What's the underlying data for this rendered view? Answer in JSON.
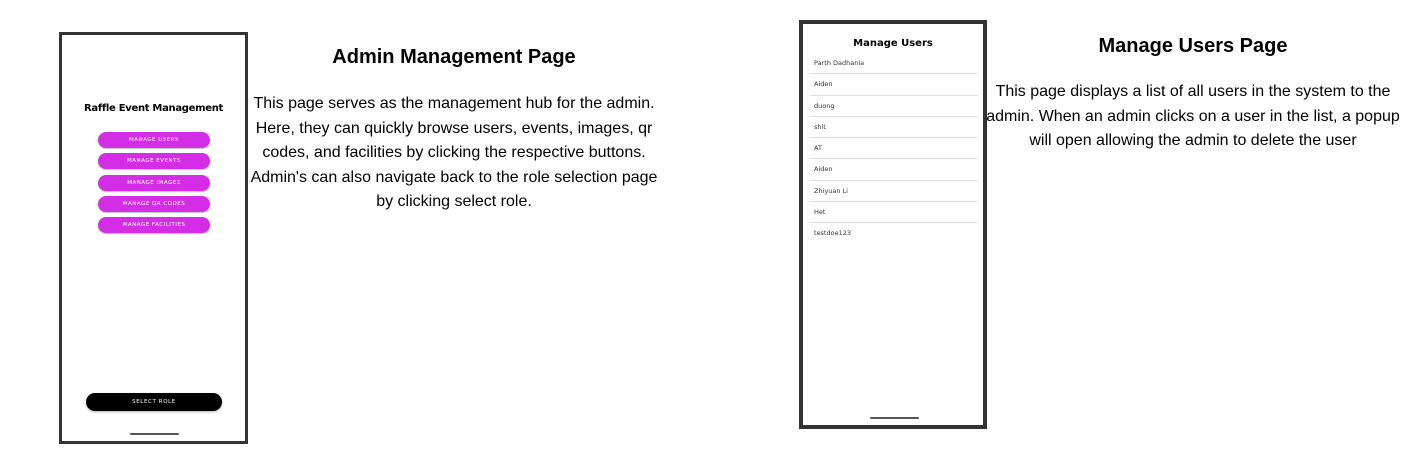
{
  "admin_screen": {
    "title": "Raffle Event Management",
    "buttons": [
      "MANAGE USERS",
      "MANAGE EVENTS",
      "MANAGE IMAGES",
      "MANAGE QR CODES",
      "MANAGE FACILITIES"
    ],
    "select_role": "SELECT ROLE",
    "button_color": "#d42de6"
  },
  "admin_description": {
    "heading": "Admin Management Page",
    "body": "This page serves as the management hub for the admin. Here, they can quickly browse users, events, images, qr codes, and facilities by clicking the respective buttons. Admin's can also navigate back to the role selection page by clicking select role."
  },
  "users_screen": {
    "title": "Manage Users",
    "users": [
      "Parth Dadhania",
      "Aiden",
      "duong",
      "shit",
      "AT",
      "Aiden",
      "Zhiyuan Li",
      "Het",
      "testdoe123"
    ]
  },
  "users_description": {
    "heading": "Manage Users Page",
    "body": "This page displays a list of all users in the system to the admin. When an admin clicks on a user in the list, a popup will open allowing the admin to delete the user"
  }
}
